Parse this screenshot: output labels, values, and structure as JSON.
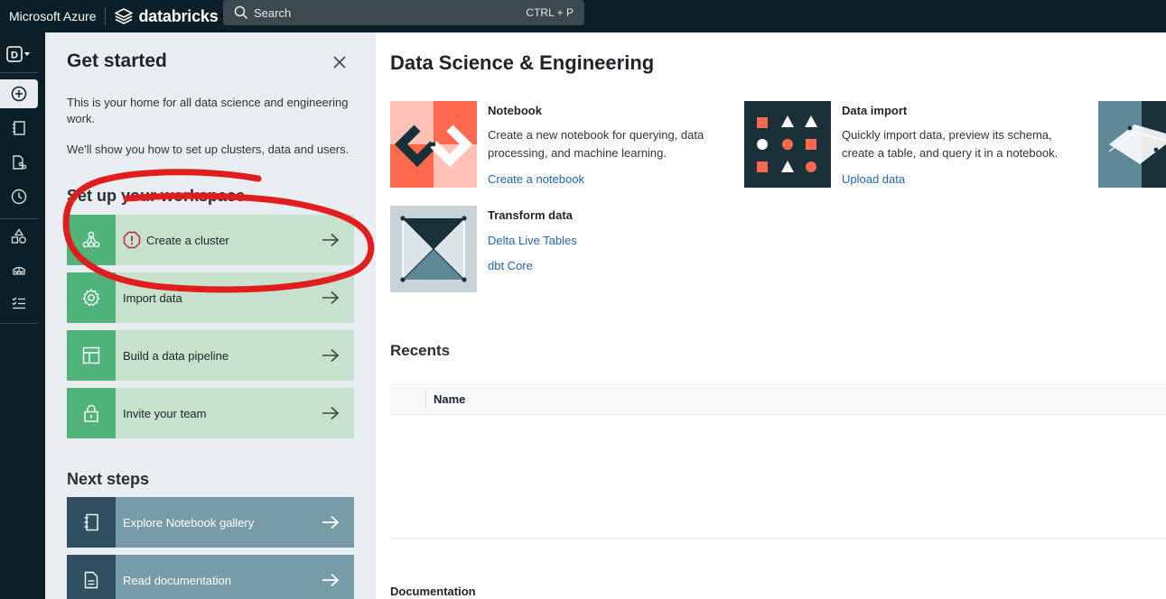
{
  "topbar": {
    "azure_label": "Microsoft Azure",
    "databricks_label": "databricks",
    "search_placeholder": "Search",
    "search_shortcut": "CTRL + P"
  },
  "rail": {
    "workspace_badge": "D",
    "items": [
      "new-icon",
      "workspace-icon",
      "repos-icon",
      "recents-icon",
      "data-icon",
      "compute-icon",
      "workflows-icon"
    ]
  },
  "get_started": {
    "title": "Get started",
    "intro_1": "This is your home for all data science and engineering work.",
    "intro_2": "We'll show you how to set up clusters, data and users.",
    "setup_heading": "Set up your workspace",
    "tasks": [
      {
        "label": "Create a cluster",
        "icon": "cluster-icon"
      },
      {
        "label": "Import data",
        "icon": "gear-icon"
      },
      {
        "label": "Build a data pipeline",
        "icon": "pipeline-icon"
      },
      {
        "label": "Invite your team",
        "icon": "lock-icon"
      }
    ],
    "next_heading": "Next steps",
    "next_steps": [
      {
        "label": "Explore Notebook gallery",
        "icon": "notebook-icon"
      },
      {
        "label": "Read documentation",
        "icon": "document-icon"
      }
    ]
  },
  "main": {
    "title": "Data Science & Engineering",
    "cards": {
      "notebook": {
        "title": "Notebook",
        "description": "Create a new notebook for querying, data processing, and machine learning.",
        "link": "Create a notebook"
      },
      "data_import": {
        "title": "Data import",
        "description": "Quickly import data, preview its schema, create a table, and query it in a notebook.",
        "link": "Upload data"
      },
      "transform": {
        "title": "Transform data",
        "links": [
          "Delta Live Tables",
          "dbt Core"
        ]
      }
    },
    "recents": {
      "title": "Recents",
      "column_name": "Name"
    },
    "documentation_title": "Documentation"
  },
  "colors": {
    "topbar": "#0b2026",
    "panel": "#e8edf1",
    "task_green": "#4fb37a",
    "task_bg": "#c6e2cd",
    "step_bg": "#789ba8",
    "link": "#2268b0",
    "annotation_red": "#e01e1e"
  }
}
